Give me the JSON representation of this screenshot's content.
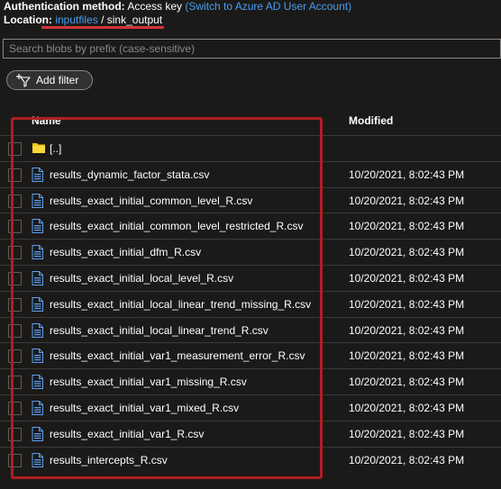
{
  "header": {
    "auth_label": "Authentication method:",
    "auth_value": "Access key",
    "auth_link": "(Switch to Azure AD User Account)",
    "location_label": "Location:",
    "location_container": "inputfiles",
    "location_separator": "/",
    "location_folder": "sink_output"
  },
  "search": {
    "placeholder": "Search blobs by prefix (case-sensitive)"
  },
  "toolbar": {
    "add_filter_label": "Add filter"
  },
  "table": {
    "columns": {
      "name": "Name",
      "modified": "Modified"
    },
    "rows": [
      {
        "type": "folder",
        "name": "[..]",
        "modified": ""
      },
      {
        "type": "file",
        "name": "results_dynamic_factor_stata.csv",
        "modified": "10/20/2021, 8:02:43 PM"
      },
      {
        "type": "file",
        "name": "results_exact_initial_common_level_R.csv",
        "modified": "10/20/2021, 8:02:43 PM"
      },
      {
        "type": "file",
        "name": "results_exact_initial_common_level_restricted_R.csv",
        "modified": "10/20/2021, 8:02:43 PM"
      },
      {
        "type": "file",
        "name": "results_exact_initial_dfm_R.csv",
        "modified": "10/20/2021, 8:02:43 PM"
      },
      {
        "type": "file",
        "name": "results_exact_initial_local_level_R.csv",
        "modified": "10/20/2021, 8:02:43 PM"
      },
      {
        "type": "file",
        "name": "results_exact_initial_local_linear_trend_missing_R.csv",
        "modified": "10/20/2021, 8:02:43 PM"
      },
      {
        "type": "file",
        "name": "results_exact_initial_local_linear_trend_R.csv",
        "modified": "10/20/2021, 8:02:43 PM"
      },
      {
        "type": "file",
        "name": "results_exact_initial_var1_measurement_error_R.csv",
        "modified": "10/20/2021, 8:02:43 PM"
      },
      {
        "type": "file",
        "name": "results_exact_initial_var1_missing_R.csv",
        "modified": "10/20/2021, 8:02:43 PM"
      },
      {
        "type": "file",
        "name": "results_exact_initial_var1_mixed_R.csv",
        "modified": "10/20/2021, 8:02:43 PM"
      },
      {
        "type": "file",
        "name": "results_exact_initial_var1_R.csv",
        "modified": "10/20/2021, 8:02:43 PM"
      },
      {
        "type": "file",
        "name": "results_intercepts_R.csv",
        "modified": "10/20/2021, 8:02:43 PM"
      }
    ]
  },
  "colors": {
    "background": "#1b1a19",
    "link": "#479ef5",
    "annotation_red": "#b01e23",
    "folder": "#f2c811",
    "file_icon": "#5ea0ef"
  },
  "icons": {
    "filter": "filter-add-icon",
    "folder": "folder-icon",
    "file": "file-icon"
  }
}
